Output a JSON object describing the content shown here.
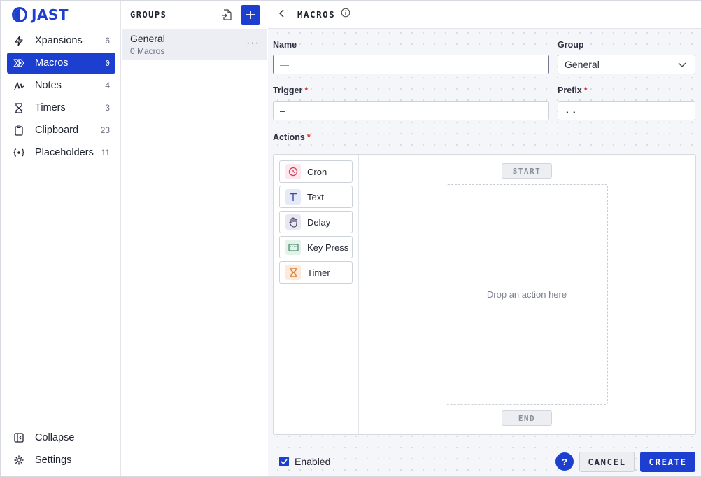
{
  "app": {
    "logo_text": "JAST"
  },
  "sidebar": {
    "items": [
      {
        "label": "Xpansions",
        "count": "6",
        "icon": "bolt-icon"
      },
      {
        "label": "Macros",
        "count": "0",
        "icon": "chevrons-right-icon",
        "active": true
      },
      {
        "label": "Notes",
        "count": "4",
        "icon": "scribble-icon"
      },
      {
        "label": "Timers",
        "count": "3",
        "icon": "hourglass-icon"
      },
      {
        "label": "Clipboard",
        "count": "23",
        "icon": "clipboard-icon"
      },
      {
        "label": "Placeholders",
        "count": "11",
        "icon": "braces-icon"
      }
    ],
    "bottom": [
      {
        "label": "Collapse",
        "icon": "sidebar-collapse-icon"
      },
      {
        "label": "Settings",
        "icon": "gear-icon"
      }
    ]
  },
  "groups": {
    "title": "GROUPS",
    "items": [
      {
        "name": "General",
        "sub": "0 Macros"
      }
    ]
  },
  "main": {
    "title": "MACROS",
    "form": {
      "name_label": "Name",
      "name_value": "—",
      "group_label": "Group",
      "group_value": "General",
      "trigger_label": "Trigger",
      "trigger_value": "–",
      "prefix_label": "Prefix",
      "prefix_value": "..",
      "actions_label": "Actions",
      "required_mark": "*"
    },
    "palette": [
      {
        "label": "Cron",
        "icon": "clock-icon",
        "color": "#d93a5a",
        "bg": "#fbe7ec"
      },
      {
        "label": "Text",
        "icon": "text-icon",
        "color": "#3b4aa8",
        "bg": "#e6e9f7"
      },
      {
        "label": "Delay",
        "icon": "hand-icon",
        "color": "#3b3f55",
        "bg": "#e8e7f3"
      },
      {
        "label": "Key Press",
        "icon": "keyboard-icon",
        "color": "#2f7a5a",
        "bg": "#e3f3ea"
      },
      {
        "label": "Timer",
        "icon": "hourglass-icon",
        "color": "#d9782a",
        "bg": "#fcebdc"
      }
    ],
    "canvas": {
      "start": "START",
      "end": "END",
      "drop_text": "Drop an action here"
    },
    "footer": {
      "enabled_label": "Enabled",
      "help": "?",
      "cancel": "CANCEL",
      "create": "CREATE"
    }
  },
  "colors": {
    "accent": "#1d3fcf"
  }
}
